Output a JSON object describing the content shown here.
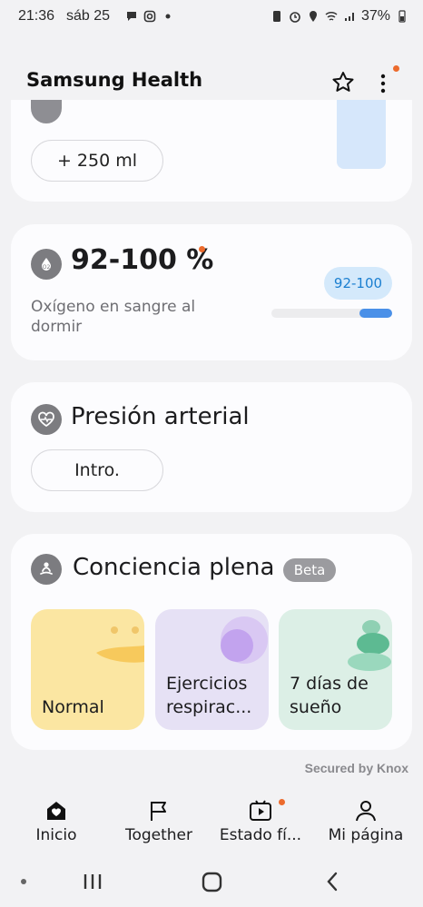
{
  "status_bar": {
    "time": "21:36",
    "date": "sáb 25",
    "battery": "37%"
  },
  "header": {
    "title": "Samsung Health"
  },
  "water": {
    "quick_add_label": "+ 250 ml"
  },
  "oxygen": {
    "value": "92-100 %",
    "description": "Oxígeno en sangre al dormir",
    "range_badge": "92-100",
    "range_fill_fraction": 0.27
  },
  "blood_pressure": {
    "title": "Presión arterial",
    "intro_label": "Intro."
  },
  "mindfulness": {
    "title": "Conciencia plena",
    "badge": "Beta",
    "tiles": [
      {
        "label": "Normal",
        "color": "#fbe6a2"
      },
      {
        "label": "Ejercicios respirac...",
        "color": "#e6e1f5"
      },
      {
        "label": "7 días de sueño",
        "color": "#dcefe6"
      }
    ]
  },
  "footer": {
    "secured": "Secured by Knox"
  },
  "bottom_nav": [
    {
      "label": "Inicio",
      "icon": "home-icon"
    },
    {
      "label": "Together",
      "icon": "flag-icon"
    },
    {
      "label": "Estado fí...",
      "icon": "fitness-video-icon"
    },
    {
      "label": "Mi página",
      "icon": "person-icon"
    }
  ],
  "colors": {
    "accent_dot": "#ec6b2d",
    "oxygen_bar": "#4a90e8",
    "badge_blue_bg": "#d4e9fb"
  }
}
